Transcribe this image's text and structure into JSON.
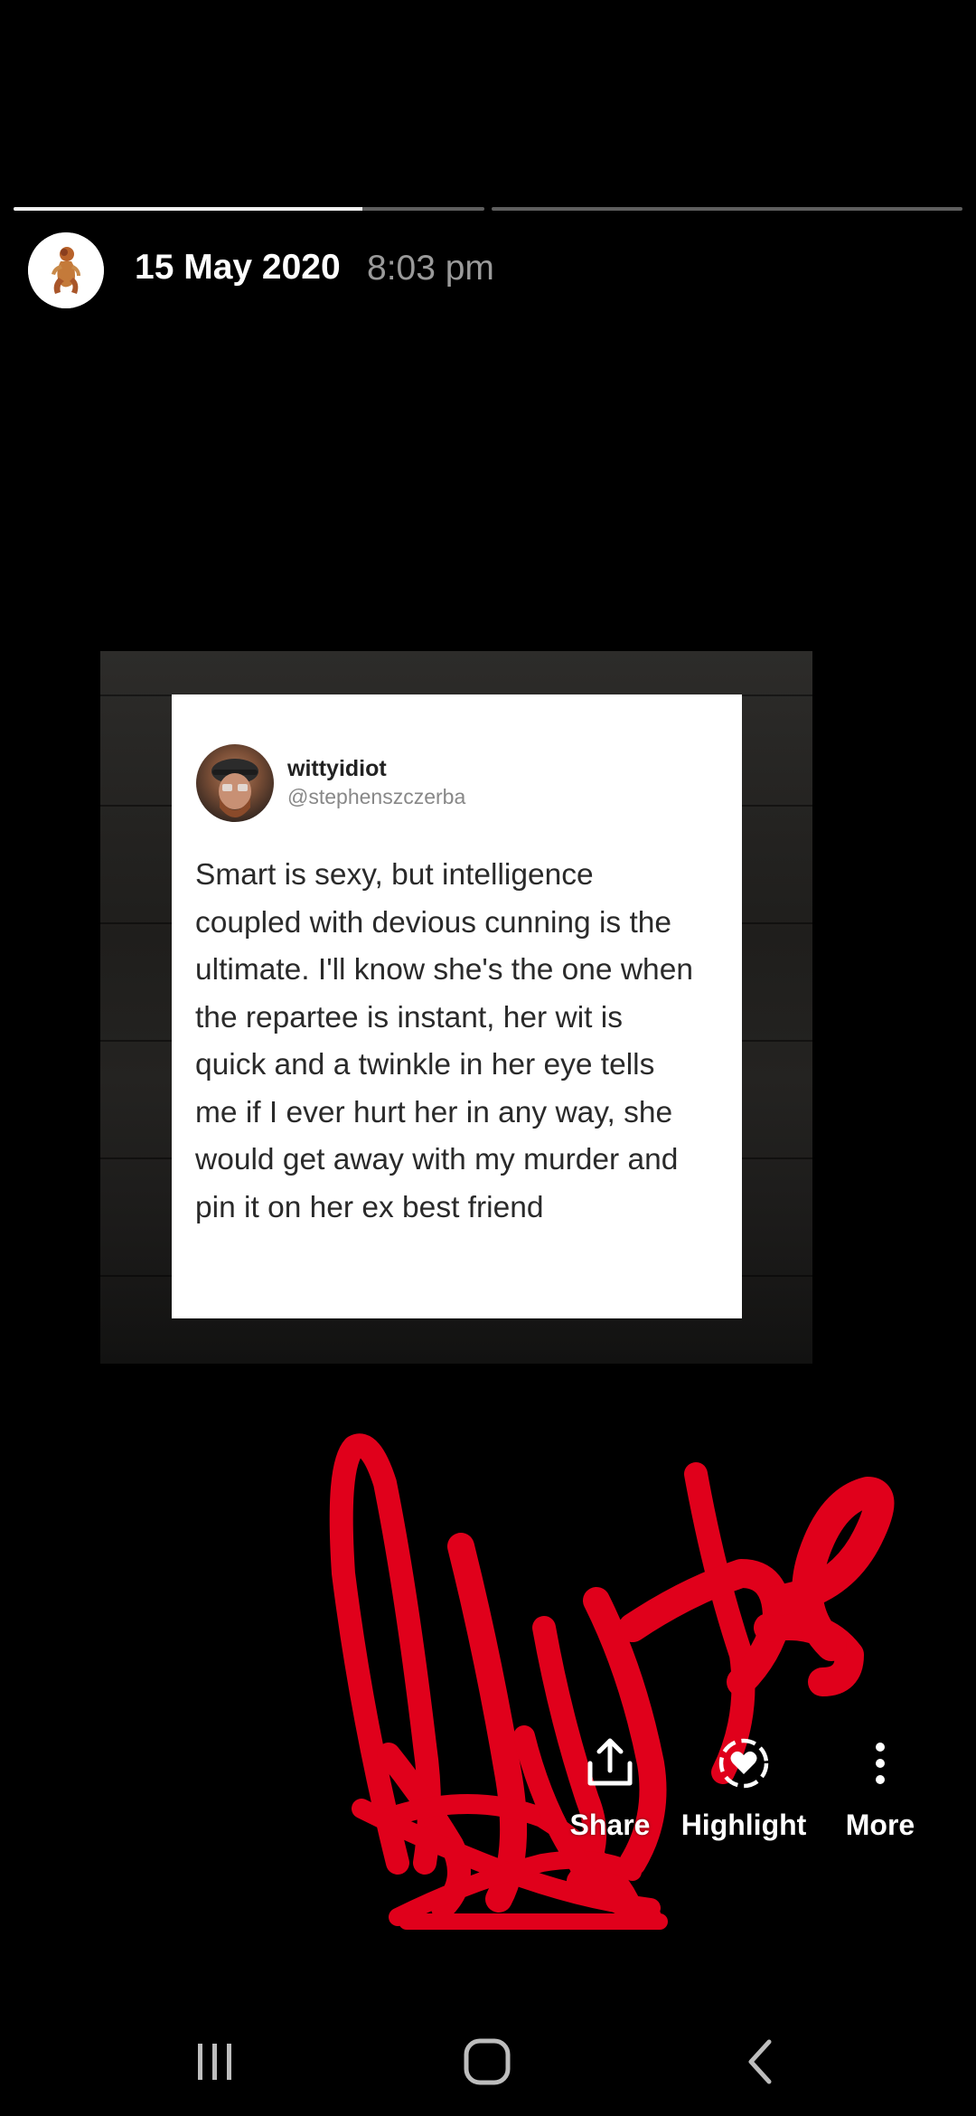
{
  "story": {
    "segments": [
      {
        "progress": 0.74
      },
      {
        "progress": 0.0
      }
    ],
    "date": "15 May 2020",
    "time": "8:03 pm"
  },
  "tweet": {
    "username": "wittyidiot",
    "handle": "@stephenszczerba",
    "lines": [
      "Smart is sexy, but intelligence",
      "coupled with devious cunning is the",
      "ultimate. I'll know she's the one when",
      "the repartee is instant, her wit is",
      "quick and a twinkle in her eye tells",
      "me if I ever hurt her in any way, she",
      "would get away with my murder and",
      "pin it on her ex best friend"
    ]
  },
  "actions": {
    "share_label": "Share",
    "highlight_label": "Highlight",
    "more_label": "More"
  },
  "colors": {
    "background": "#000000",
    "signature": "#e0001b",
    "progress_track": "#5e5e5e",
    "progress_fill": "#f2f2f2"
  },
  "icons": {
    "share": "share-icon",
    "highlight": "highlight-heart-icon",
    "more": "more-vertical-icon",
    "recents": "recents-icon",
    "home": "home-icon",
    "back": "back-icon"
  }
}
